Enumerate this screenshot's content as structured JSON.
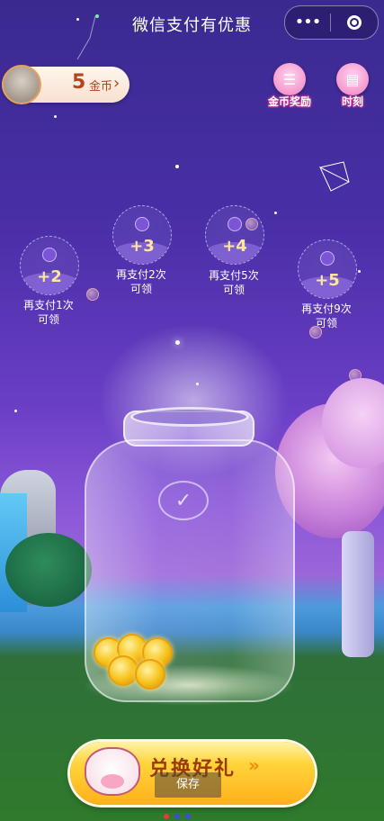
{
  "header": {
    "title": "微信支付有优惠",
    "more_glyph": "•••",
    "close_icon": "target-icon"
  },
  "wallet": {
    "coins": "5",
    "unit": "金币",
    "chevron": "›"
  },
  "top_actions": [
    {
      "label": "金币奖励",
      "icon": "list-icon"
    },
    {
      "label": "时刻",
      "icon": "calendar-icon"
    }
  ],
  "rewards": [
    {
      "points": "+2",
      "caption_line1": "再支付1次",
      "caption_line2": "可领"
    },
    {
      "points": "+3",
      "caption_line1": "再支付2次",
      "caption_line2": "可领"
    },
    {
      "points": "+4",
      "caption_line1": "再支付5次",
      "caption_line2": "可领"
    },
    {
      "points": "+5",
      "caption_line1": "再支付9次",
      "caption_line2": "可领"
    }
  ],
  "jar": {
    "logo_icon": "wechat-pay-icon"
  },
  "cta": {
    "label": "兑换好礼",
    "arrows": "»",
    "save_label": "保存"
  },
  "colors": {
    "accent_gold": "#ffd43a",
    "coin_text": "#b4441d",
    "sky_purple": "#4a2fa8"
  }
}
